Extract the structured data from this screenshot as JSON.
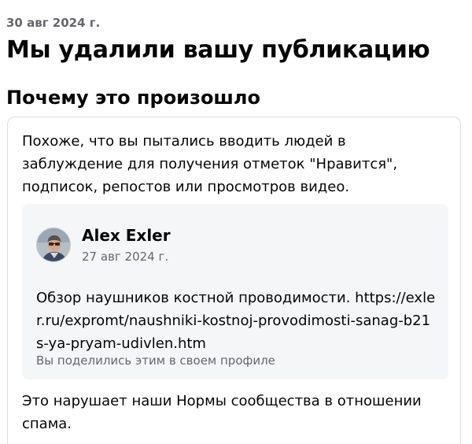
{
  "notice": {
    "date": "30 авг 2024 г.",
    "title": "Мы удалили вашу публикацию",
    "section_heading": "Почему это произошло",
    "reason": "Похоже, что вы пытались вводить людей в заблуждение для получения отметок \"Нравится\", подписок, репостов или просмотров видео.",
    "violation": "Это нарушает наши Нормы сообщества в отношении спама."
  },
  "post": {
    "avatar_icon": "user-avatar-icon",
    "author": "Alex Exler",
    "date": "27 авг 2024 г.",
    "text": "Обзор наушников костной проводимости. https://exler.ru/expromt/naushniki-kostnoj-provodimosti-sanag-b21s-ya-pryam-udivlen.htm",
    "share_note": "Вы поделились этим в своем профиле"
  },
  "colors": {
    "primary_text": "#050505",
    "secondary_text": "#65676b",
    "card_border": "#dadde1",
    "post_background": "#f5f6f8"
  }
}
